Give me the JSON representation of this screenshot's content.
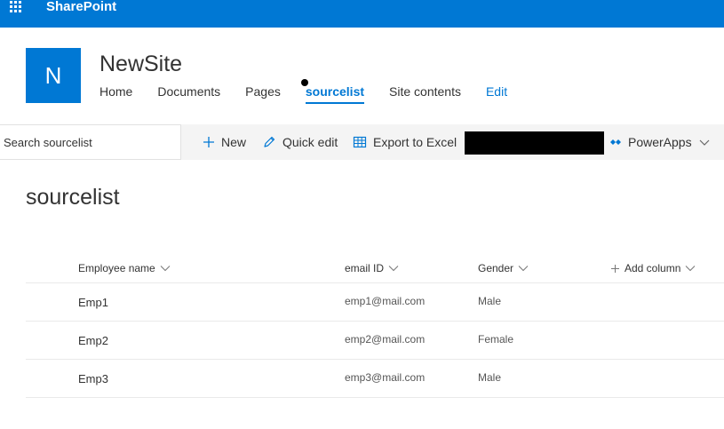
{
  "suite_bar": {
    "brand": "SharePoint"
  },
  "site": {
    "logo_letter": "N",
    "title": "NewSite",
    "nav": [
      "Home",
      "Documents",
      "Pages",
      "sourcelist",
      "Site contents",
      "Edit"
    ]
  },
  "command_bar": {
    "search_placeholder": "Search sourcelist",
    "new_label": "New",
    "quick_edit_label": "Quick edit",
    "export_label": "Export to Excel",
    "powerapps_label": "PowerApps"
  },
  "list": {
    "title": "sourcelist",
    "columns": {
      "employee_name": "Employee name",
      "email": "email ID",
      "gender": "Gender",
      "add_column": "Add column"
    },
    "rows": [
      {
        "name": "Emp1",
        "email": "emp1@mail.com",
        "gender": "Male"
      },
      {
        "name": "Emp2",
        "email": "emp2@mail.com",
        "gender": "Female"
      },
      {
        "name": "Emp3",
        "email": "emp3@mail.com",
        "gender": "Male"
      }
    ]
  },
  "colors": {
    "accent": "#0078d4",
    "command_bar_bg": "#f4f4f4"
  }
}
